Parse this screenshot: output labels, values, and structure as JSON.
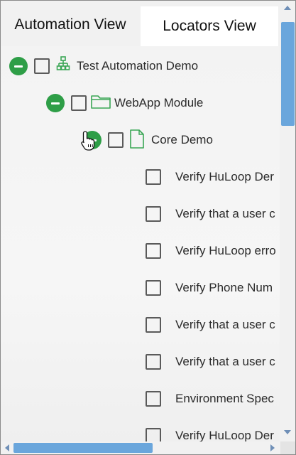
{
  "tabs": {
    "automation": "Automation View",
    "locators": "Locators View",
    "active": "Locators View"
  },
  "tree": {
    "root": {
      "label": "Test Automation Demo",
      "icon": "hierarchy-icon",
      "expanded": true,
      "checked": false
    },
    "module": {
      "label": "WebApp Module",
      "icon": "folder-icon",
      "expanded": true,
      "checked": false
    },
    "suite": {
      "label": "Core Demo",
      "icon": "file-icon",
      "expanded": true,
      "checked": false
    },
    "leaves": [
      "Verify HuLoop Der",
      "Verify that a user c",
      "Verify HuLoop erro",
      "Verify Phone Num",
      "Verify that a user c",
      "Verify that a user c",
      "Environment Spec",
      "Verify HuLoop Der"
    ]
  },
  "colors": {
    "toggle": "#2e9e47",
    "icon_green": "#3aa655",
    "scroll_thumb": "#6aa6dc"
  }
}
